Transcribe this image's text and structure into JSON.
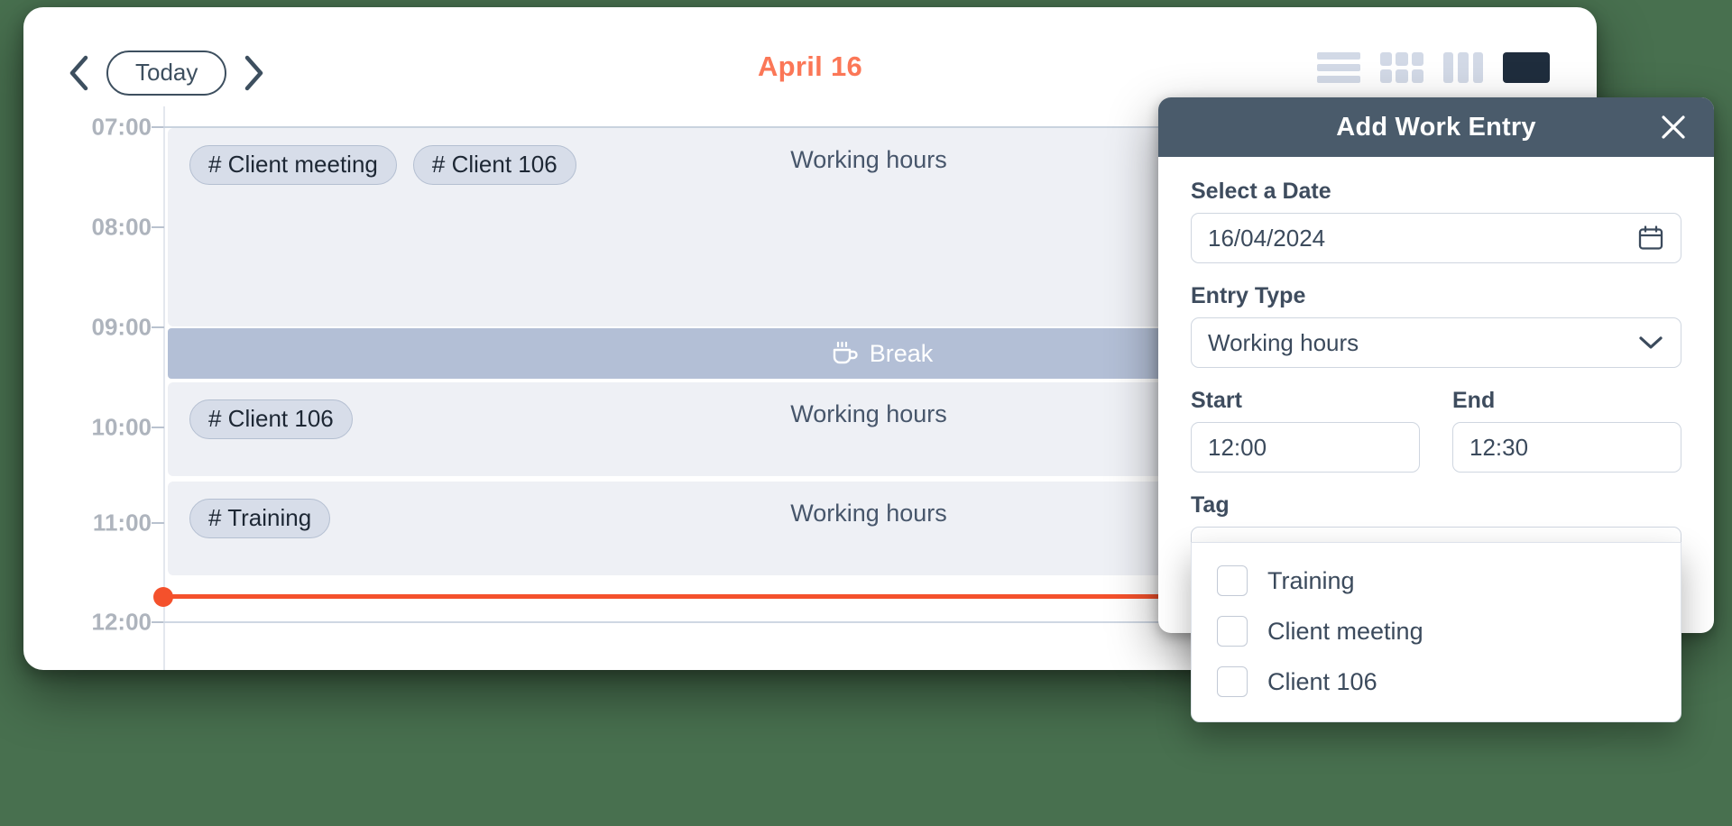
{
  "calendar": {
    "nav": {
      "prev_icon": "chevron-left-icon",
      "today_label": "Today",
      "next_icon": "chevron-right-icon"
    },
    "title": "April 16",
    "title_color": "#fb7757",
    "view_toggles": [
      {
        "name": "list-view-icon",
        "active": false
      },
      {
        "name": "grid-view-icon",
        "active": false
      },
      {
        "name": "column-view-icon",
        "active": false
      },
      {
        "name": "day-view-icon",
        "active": true
      }
    ],
    "hours": [
      "07:00",
      "08:00",
      "09:00",
      "10:00",
      "11:00",
      "12:00"
    ],
    "events": [
      {
        "tags": [
          "# Client meeting",
          "# Client 106"
        ],
        "type": "Working hours"
      },
      {
        "tags": [
          "# Client 106"
        ],
        "type": "Working hours"
      },
      {
        "tags": [
          "# Training"
        ],
        "type": "Working hours"
      }
    ],
    "break": {
      "label": "Break",
      "icon": "coffee-cup-icon"
    },
    "now_indicator": {
      "color": "#f4512c"
    }
  },
  "modal": {
    "title": "Add Work Entry",
    "close_icon": "close-icon",
    "date": {
      "label": "Select a Date",
      "value": "16/04/2024",
      "icon": "calendar-icon"
    },
    "entry_type": {
      "label": "Entry Type",
      "value": "Working hours",
      "icon": "chevron-down-icon"
    },
    "start": {
      "label": "Start",
      "value": "12:00"
    },
    "end": {
      "label": "End",
      "value": "12:30"
    },
    "tag": {
      "label": "Tag",
      "value": "",
      "icon": "chevron-down-icon",
      "options": [
        {
          "label": "Training",
          "checked": false
        },
        {
          "label": "Client meeting",
          "checked": false
        },
        {
          "label": "Client 106",
          "checked": false
        }
      ]
    }
  }
}
